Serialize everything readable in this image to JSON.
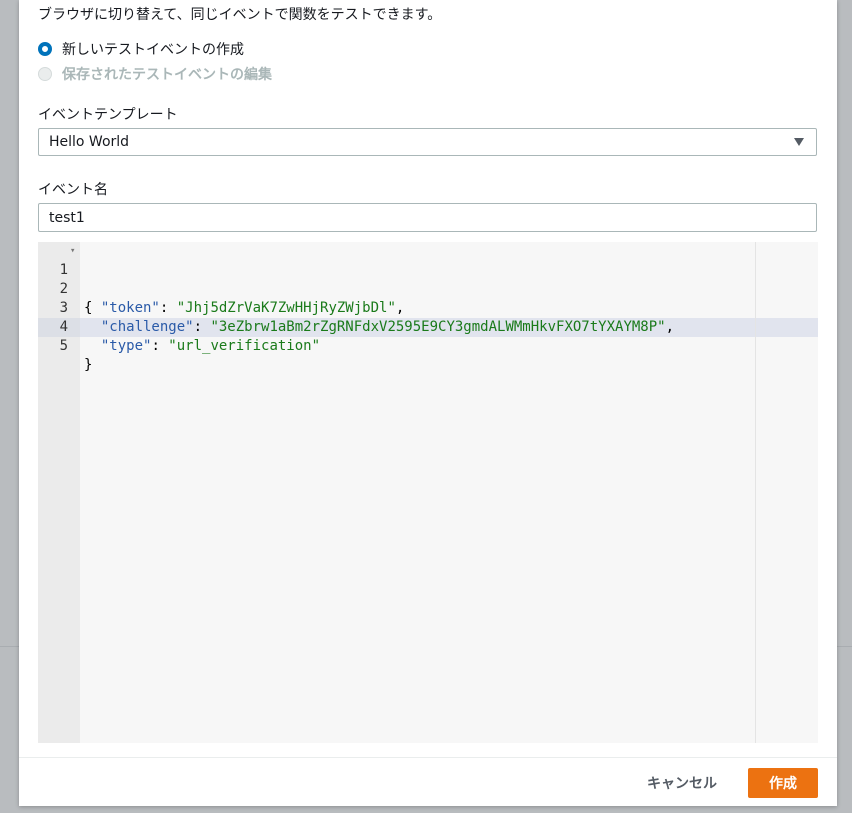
{
  "modal": {
    "intro_text": "ブラウザに切り替えて、同じイベントで関数をテストできます。",
    "radio_options": [
      {
        "label": "新しいテストイベントの作成",
        "selected": true
      },
      {
        "label": "保存されたテストイベントの編集",
        "selected": false
      }
    ],
    "template": {
      "label": "イベントテンプレート",
      "selected_value": "Hello World"
    },
    "event_name": {
      "label": "イベント名",
      "value": "test1"
    },
    "editor": {
      "line_numbers": [
        "1",
        "2",
        "3",
        "4",
        "5"
      ],
      "open_brace": "{",
      "close_brace": "}",
      "token_key": "\"token\"",
      "token_value": "\"Jhj5dZrVaK7ZwHHjRyZWjbDl\"",
      "challenge_key": "\"challenge\"",
      "challenge_value": "\"3eZbrw1aBm2rZgRNFdxV2595E9CY3gmdALWMmHkvFXO7tYXAYM8P\"",
      "type_key": "\"type\"",
      "type_value": "\"url_verification\""
    },
    "footer": {
      "cancel_label": "キャンセル",
      "create_label": "作成"
    }
  },
  "colors": {
    "accent_radio": "#0073bb",
    "primary_button": "#ec7211",
    "string_literal": "#1a7a1a",
    "json_key": "#2a5aa8"
  }
}
